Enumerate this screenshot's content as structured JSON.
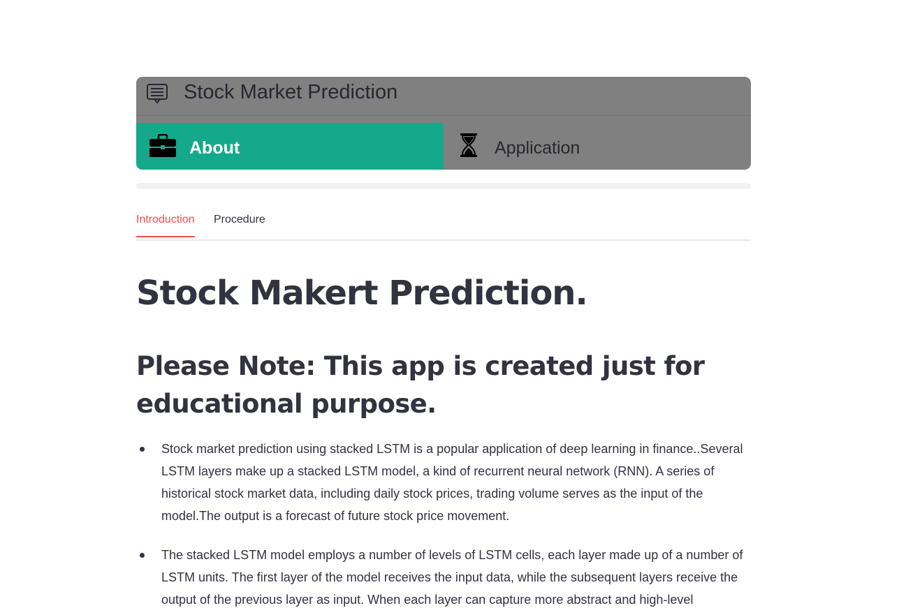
{
  "menu": {
    "title": "Stock Market Prediction",
    "title_icon": "menu-card-icon",
    "items": [
      {
        "label": "About",
        "icon": "briefcase-icon",
        "active": true
      },
      {
        "label": "Application",
        "icon": "hourglass-icon",
        "active": false
      }
    ],
    "active_color": "#14a98a",
    "background_color": "#808080"
  },
  "tabs": [
    {
      "label": "Introduction",
      "active": true
    },
    {
      "label": "Procedure",
      "active": false
    }
  ],
  "content": {
    "title": "Stock Makert Prediction.",
    "note": "Please Note: This app is created just for educational purpose.",
    "bullets": [
      "Stock market prediction using stacked LSTM is a popular application of deep learning in finance..Several LSTM layers make up a stacked LSTM model, a kind of recurrent neural network (RNN). A series of historical stock market data, including daily stock prices, trading volume serves as the input of the model.The output is a forecast of future stock price movement.",
      "The stacked LSTM model employs a number of levels of LSTM cells, each layer made up of a number of LSTM units. The first layer of the model receives the input data, while the subsequent layers receive the output of the previous layer as input. When each layer can capture more abstract and high-level"
    ]
  },
  "colors": {
    "accent": "#ff4b4b",
    "text": "#31333f"
  }
}
